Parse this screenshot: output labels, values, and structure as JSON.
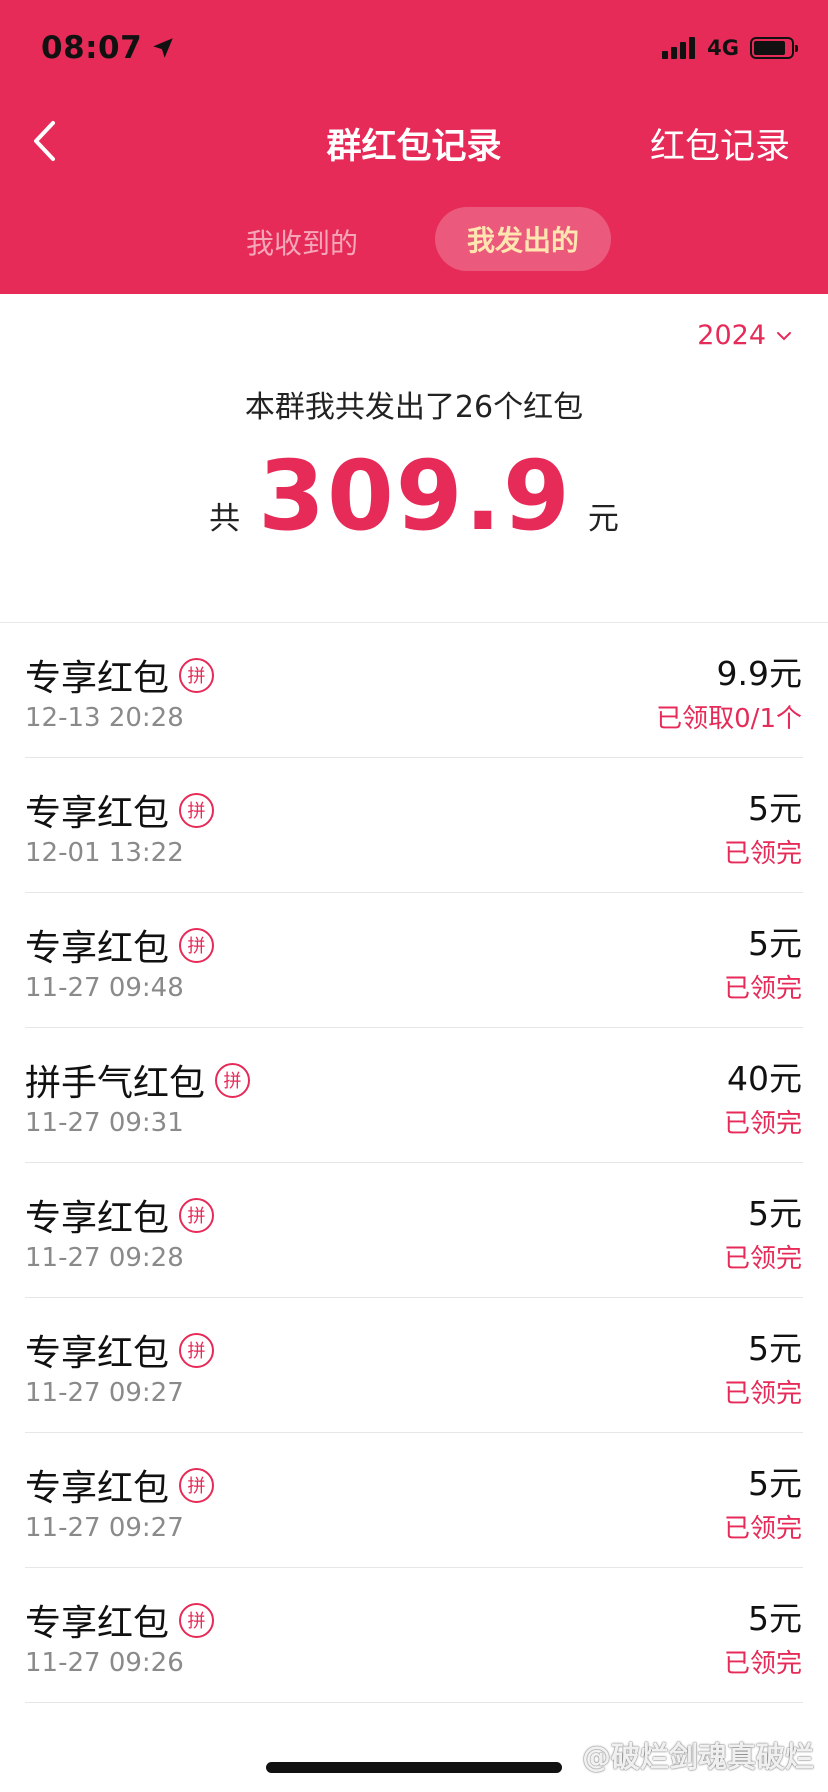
{
  "status_bar": {
    "time": "08:07",
    "network": "4G",
    "battery_level": 0.85
  },
  "nav": {
    "title": "群红包记录",
    "right_link": "红包记录"
  },
  "tabs": [
    {
      "label": "我收到的",
      "active": false
    },
    {
      "label": "我发出的",
      "active": true
    }
  ],
  "year_filter": "2024",
  "summary": {
    "text": "本群我共发出了26个红包",
    "prefix": "共",
    "amount": "309.9",
    "suffix": "元"
  },
  "badge_char": "拼",
  "records": [
    {
      "name": "专享红包",
      "time": "12-13 20:28",
      "amount": "9.9元",
      "status": "已领取0/1个"
    },
    {
      "name": "专享红包",
      "time": "12-01 13:22",
      "amount": "5元",
      "status": "已领完"
    },
    {
      "name": "专享红包",
      "time": "11-27 09:48",
      "amount": "5元",
      "status": "已领完"
    },
    {
      "name": "拼手气红包",
      "time": "11-27 09:31",
      "amount": "40元",
      "status": "已领完"
    },
    {
      "name": "专享红包",
      "time": "11-27 09:28",
      "amount": "5元",
      "status": "已领完"
    },
    {
      "name": "专享红包",
      "time": "11-27 09:27",
      "amount": "5元",
      "status": "已领完"
    },
    {
      "name": "专享红包",
      "time": "11-27 09:27",
      "amount": "5元",
      "status": "已领完"
    },
    {
      "name": "专享红包",
      "time": "11-27 09:26",
      "amount": "5元",
      "status": "已领完"
    }
  ],
  "watermark": "@破烂剑魂真破烂",
  "colors": {
    "brand_red": "#e62b58",
    "active_tab_text": "#ffe6b0"
  }
}
